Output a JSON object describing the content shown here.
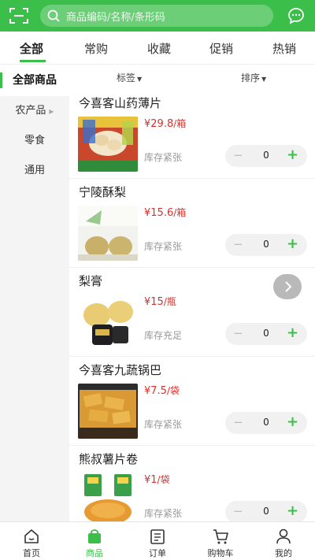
{
  "search": {
    "placeholder": "商品编码/名称/条形码"
  },
  "tabs": [
    {
      "label": "全部",
      "active": true
    },
    {
      "label": "常购"
    },
    {
      "label": "收藏"
    },
    {
      "label": "促销"
    },
    {
      "label": "热销"
    }
  ],
  "filters": {
    "tag_label": "标签",
    "sort_label": "排序"
  },
  "sidebar": {
    "items": [
      {
        "label": "全部商品",
        "active": true
      },
      {
        "label": "农产品",
        "has_children": true
      },
      {
        "label": "零食"
      },
      {
        "label": "通用"
      }
    ]
  },
  "products": [
    {
      "name": "今喜客山药薄片",
      "price": "¥29.8",
      "unit": "/箱",
      "stock": "库存紧张",
      "qty": "0",
      "image_text": "山药薄片片片美味"
    },
    {
      "name": "宁陵酥梨",
      "price": "¥15.6",
      "unit": "/箱",
      "stock": "库存紧张",
      "qty": "0",
      "image_text": "梨乡"
    },
    {
      "name": "梨膏",
      "price": "¥15",
      "unit": "/瓶",
      "stock": "库存充足",
      "qty": "0",
      "image_text": ""
    },
    {
      "name": "今喜客九蔬锅巴",
      "price": "¥7.5",
      "unit": "/袋",
      "stock": "库存紧张",
      "qty": "0",
      "image_text": "今喜客九蔬锅巴"
    },
    {
      "name": "熊叔薯片卷",
      "price": "¥1",
      "unit": "/袋",
      "stock": "库存紧张",
      "qty": "0",
      "image_text": ""
    }
  ],
  "stepper": {
    "minus": "−",
    "plus": "+"
  },
  "bottom_nav": [
    {
      "label": "首页",
      "icon": "home-icon"
    },
    {
      "label": "商品",
      "icon": "bag-icon",
      "active": true
    },
    {
      "label": "订单",
      "icon": "order-icon"
    },
    {
      "label": "购物车",
      "icon": "cart-icon"
    },
    {
      "label": "我的",
      "icon": "user-icon"
    }
  ],
  "colors": {
    "accent": "#3bbf4a",
    "price": "#d9302b"
  }
}
